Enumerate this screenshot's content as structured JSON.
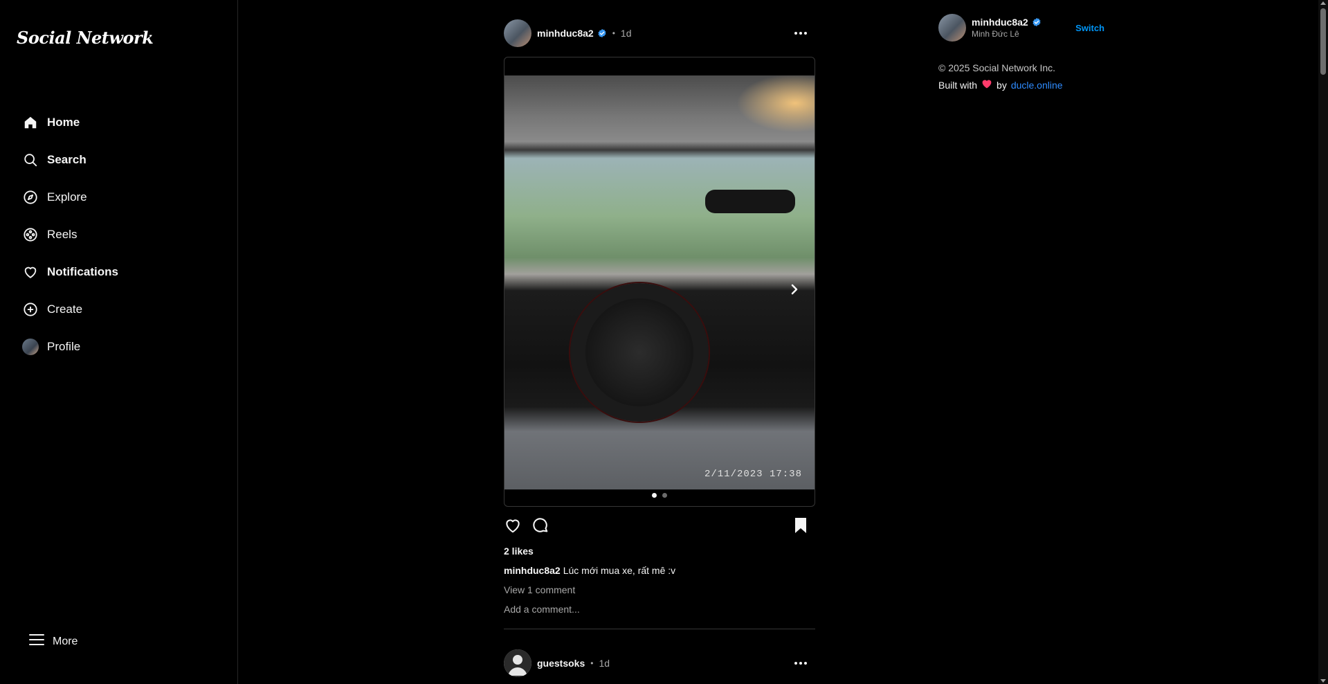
{
  "app": {
    "logo": "Social Network"
  },
  "sidebar": {
    "items": [
      {
        "label": "Home",
        "icon": "home-icon"
      },
      {
        "label": "Search",
        "icon": "search-icon"
      },
      {
        "label": "Explore",
        "icon": "compass-icon"
      },
      {
        "label": "Reels",
        "icon": "reels-icon"
      },
      {
        "label": "Notifications",
        "icon": "heart-icon"
      },
      {
        "label": "Create",
        "icon": "plus-circle-icon"
      },
      {
        "label": "Profile",
        "icon": "avatar"
      }
    ],
    "more_label": "More"
  },
  "post": {
    "username": "minhduc8a2",
    "time": "1d",
    "separator": "•",
    "photo_timestamp": "2/11/2023 17:38",
    "slides_total": 2,
    "slide_active": 1,
    "likes": "2 likes",
    "caption_user": "minhduc8a2",
    "caption_text": "Lúc mới mua xe, rất mê :v",
    "view_comments": "View 1 comment",
    "add_comment_placeholder": "Add a comment..."
  },
  "next_post": {
    "username": "guestsoks",
    "time": "1d",
    "separator": "•"
  },
  "right_panel": {
    "username": "minhduc8a2",
    "full_name": "Minh Đức Lê",
    "switch_label": "Switch",
    "copyright": "© 2025 Social Network Inc.",
    "built_with": "Built with",
    "by": "by",
    "site_link": "ducle.online"
  },
  "colors": {
    "background": "#000000",
    "accent": "#0095f6",
    "verified": "#3897f0",
    "heart": "#ff3b6b"
  }
}
